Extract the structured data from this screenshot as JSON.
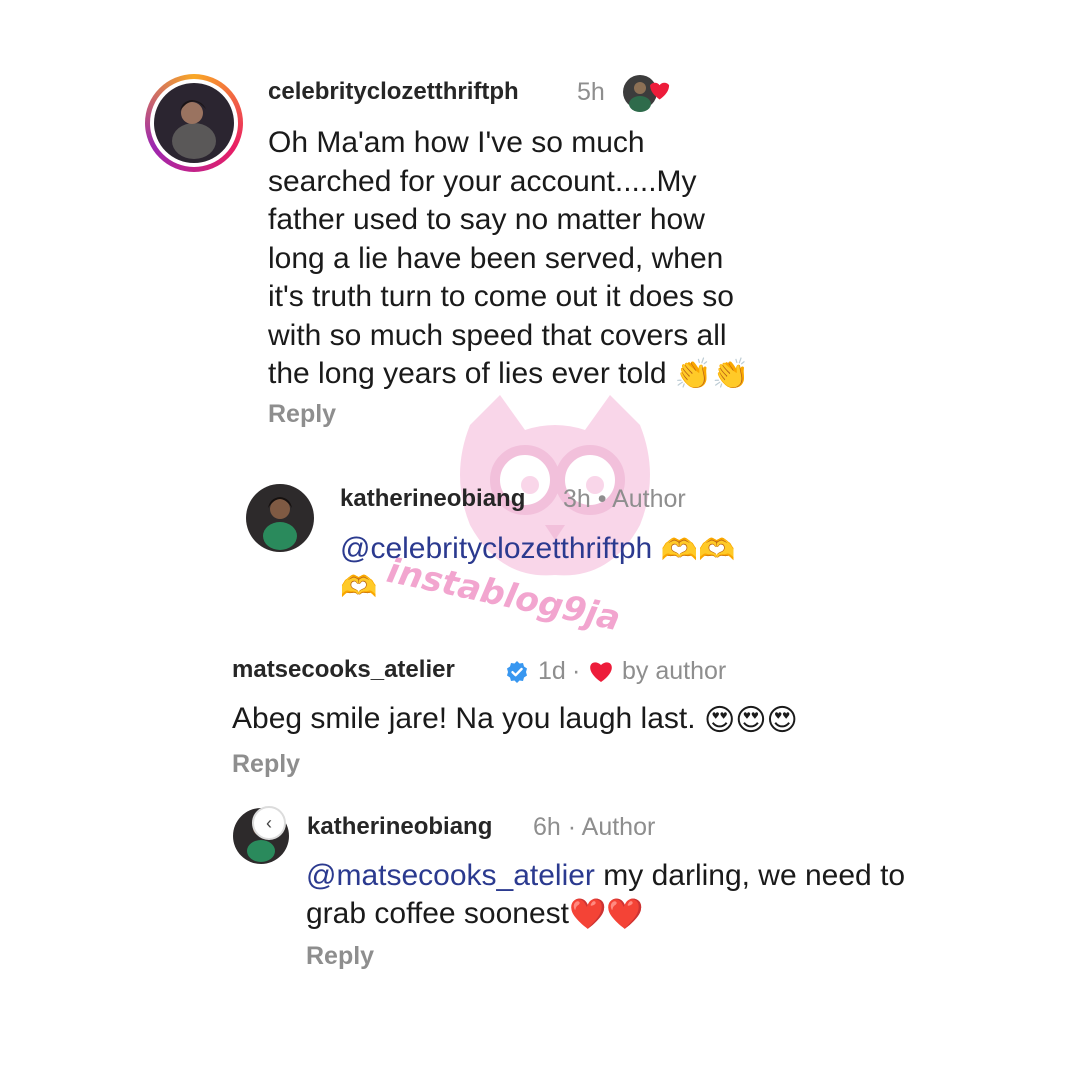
{
  "comments": [
    {
      "username": "celebrityclozetthriftph",
      "time": "5h",
      "text_lines": [
        "Oh Ma'am how I've so much",
        "searched for your account.....My",
        "father used to say no matter how",
        "long a lie have been served, when",
        "it's truth turn to come out it does so",
        "with so much speed that covers all",
        "the long years of lies ever told"
      ],
      "text_emojis": "👏👏",
      "reply_label": "Reply"
    },
    {
      "username": "katherineobiang",
      "time": "3h",
      "role": "• Author",
      "mention": "@celebrityclozetthriftph",
      "emojis": "🫶🫶",
      "emojis_line2": "🫶"
    },
    {
      "username": "matsecooks_atelier",
      "time": "1d",
      "liked_by": "by author",
      "text": "Abeg smile jare! Na you laugh last.",
      "emojis": "😍😍😍",
      "reply_label": "Reply"
    },
    {
      "username": "katherineobiang",
      "time": "6h",
      "role": "· Author",
      "mention": "@matsecooks_atelier",
      "text_line1": " my darling, we need to",
      "text_line2": "grab coffee soonest",
      "emojis": "❤️❤️",
      "reply_label": "Reply"
    }
  ],
  "watermark": {
    "text": "instablog9ja",
    "color": "#f2a5cf"
  },
  "colors": {
    "mention": "#2b3a8f",
    "meta": "#8e8e8e",
    "verified": "#3897f0",
    "heart": "#ed1c3a"
  }
}
